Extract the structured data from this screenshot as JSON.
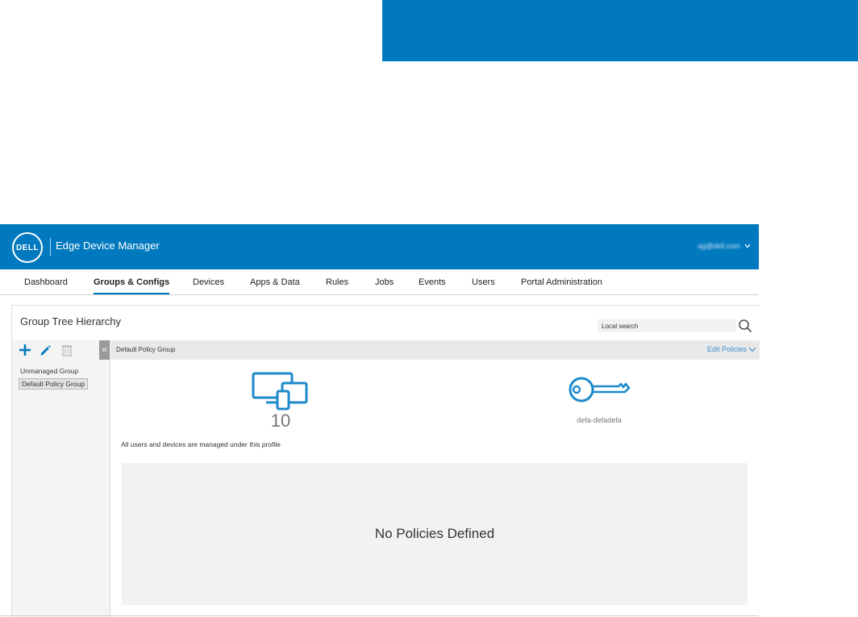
{
  "header": {
    "logo_text": "DELL",
    "app_title": "Edge Device Manager",
    "user_email": "ag@dell.com",
    "accent_color": "#0079be"
  },
  "nav": {
    "items": [
      {
        "label": "Dashboard",
        "active": false
      },
      {
        "label": "Groups & Configs",
        "active": true
      },
      {
        "label": "Devices",
        "active": false
      },
      {
        "label": "Apps & Data",
        "active": false
      },
      {
        "label": "Rules",
        "active": false
      },
      {
        "label": "Jobs",
        "active": false
      },
      {
        "label": "Events",
        "active": false
      },
      {
        "label": "Users",
        "active": false
      },
      {
        "label": "Portal Administration",
        "active": false
      }
    ]
  },
  "panel": {
    "title": "Group Tree Hierarchy",
    "search_placeholder": "Local search"
  },
  "sidebar": {
    "toolbar_icons": [
      "add-icon",
      "edit-icon",
      "trash-icon"
    ],
    "collapse_glyph": "«",
    "groups": [
      {
        "label": "Unmanaged Group",
        "selected": false
      },
      {
        "label": "Default Policy Group",
        "selected": true
      }
    ]
  },
  "content": {
    "breadcrumb": "Default Policy Group",
    "edit_policies_label": "Edit Policies",
    "device_count": "10",
    "key_label": "defa-defadefa",
    "profile_note": "All users and devices are managed under this profile",
    "empty_policies": "No Policies Defined"
  }
}
